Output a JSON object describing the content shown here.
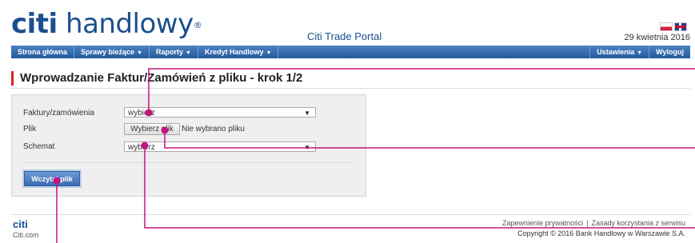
{
  "header": {
    "logo_prefix": "citi",
    "logo_suffix": " handlowy",
    "logo_mark": "®",
    "portal_title": "Citi Trade Portal",
    "date": "29 kwietnia 2016",
    "language_flags": [
      "pl-flag-icon",
      "uk-flag-icon"
    ]
  },
  "nav": {
    "left_items": [
      {
        "label": "Strona główna",
        "has_dropdown": false
      },
      {
        "label": "Sprawy bieżące",
        "has_dropdown": true
      },
      {
        "label": "Raporty",
        "has_dropdown": true
      },
      {
        "label": "Kredyt Handlowy",
        "has_dropdown": true
      }
    ],
    "right_items": [
      {
        "label": "Ustawienia",
        "has_dropdown": true
      },
      {
        "label": "Wyloguj",
        "has_dropdown": false
      }
    ],
    "caret": "▼"
  },
  "page": {
    "title": "Wprowadzanie Faktur/Zamówień z pliku - krok 1/2"
  },
  "form": {
    "invoices_label": "Faktury/zamówienia",
    "invoices_value": "wybierz",
    "file_label": "Plik",
    "file_button": "Wybierz plik",
    "file_status": "Nie wybrano pliku",
    "schema_label": "Schemat",
    "schema_value": "wybierz",
    "select_arrow": "▼",
    "load_button": "Wczytaj plik"
  },
  "footer": {
    "logo": "citi",
    "site": "Citi.com",
    "privacy_link": "Zapewnienie prywatności",
    "separator": "|",
    "terms_link": "Zasady korzystania z serwisu",
    "copyright": "Copyright © 2016 Bank Handlowy w Warszawie S.A."
  },
  "colors": {
    "brand_blue": "#1b4f8f",
    "nav_blue": "#245a9b",
    "title_accent": "#d9261c",
    "callout_magenta": "#c6137e"
  }
}
